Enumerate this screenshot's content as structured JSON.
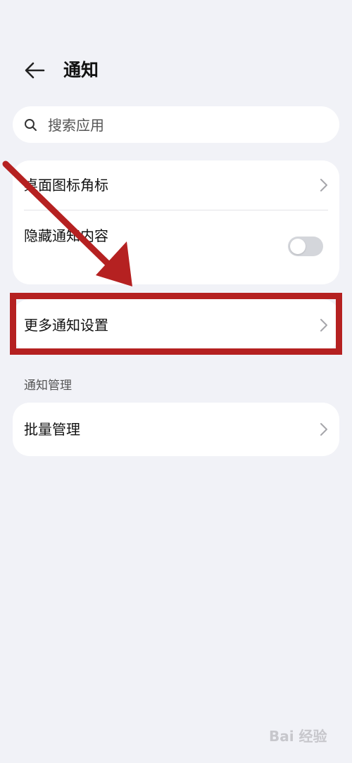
{
  "header": {
    "title": "通知"
  },
  "search": {
    "placeholder": "搜索应用"
  },
  "card1": {
    "rows": [
      {
        "label": "桌面图标角标"
      },
      {
        "label": "隐藏通知内容",
        "toggle_on": false
      }
    ]
  },
  "card2": {
    "rows": [
      {
        "label": "更多通知设置"
      }
    ]
  },
  "section": {
    "title": "通知管理"
  },
  "card3": {
    "rows": [
      {
        "label": "批量管理"
      }
    ]
  },
  "annotation": {
    "color": "#b52121"
  },
  "watermark": {
    "text": "Bai 经验"
  },
  "colors": {
    "background": "#f1f2f7",
    "card": "#ffffff",
    "toggle_off": "#d4d6db"
  }
}
